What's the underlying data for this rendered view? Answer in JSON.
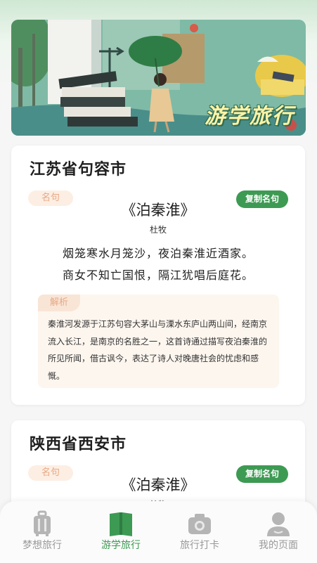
{
  "banner": {
    "title": "游学旅行"
  },
  "cards": [
    {
      "city": "江苏省句容市",
      "famous_tag": "名句",
      "copy_button": "复制名句",
      "poem_title": "《泊秦淮》",
      "author": "杜牧",
      "verses": [
        "烟笼寒水月笼沙，夜泊秦淮近酒家。",
        "商女不知亡国恨，隔江犹唱后庭花。"
      ],
      "analysis_tag": "解析",
      "analysis_text": "秦淮河发源于江苏句容大茅山与溧水东庐山两山间，经南京流入长江，是南京的名胜之一，这首诗通过描写夜泊秦淮的所见所闻，借古讽今，表达了诗人对晚唐社会的忧虑和感慨。"
    },
    {
      "city": "陕西省西安市",
      "famous_tag": "名句",
      "copy_button": "复制名句",
      "poem_title": "《泊秦淮》",
      "author": "杜牧"
    }
  ],
  "nav": {
    "items": [
      {
        "label": "梦想旅行",
        "icon": "suitcase-icon",
        "active": false
      },
      {
        "label": "游学旅行",
        "icon": "book-icon",
        "active": true
      },
      {
        "label": "旅行打卡",
        "icon": "camera-icon",
        "active": false
      },
      {
        "label": "我的页面",
        "icon": "user-icon",
        "active": false
      }
    ]
  },
  "colors": {
    "accent": "#3d9a53",
    "tag_bg": "#fdeee3",
    "tag_text": "#e6a986",
    "inactive": "#9a9a9a"
  }
}
